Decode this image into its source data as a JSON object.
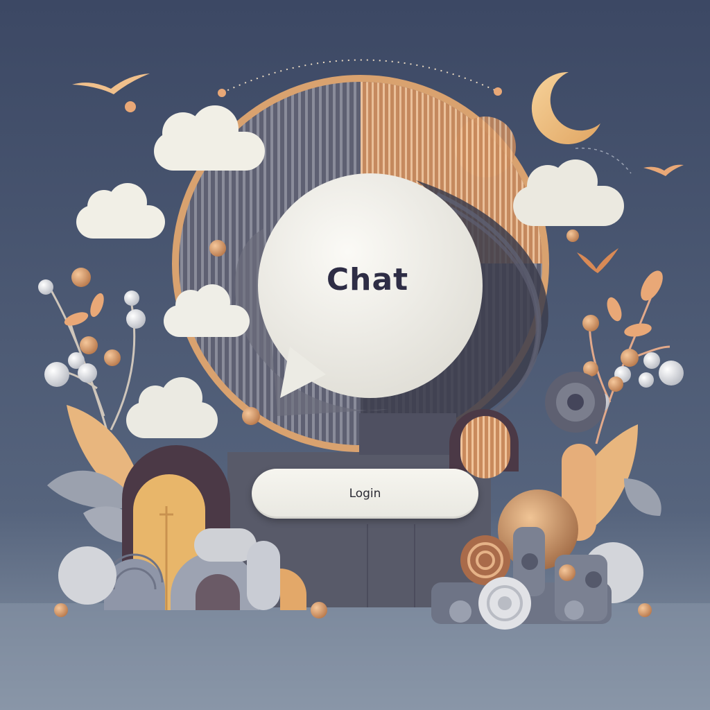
{
  "chat_bubble": {
    "label": "Chat"
  },
  "login_button": {
    "label": "Login"
  },
  "colors": {
    "background_top": "#3e4a66",
    "background_bottom": "#7a8698",
    "floor": "#8694a7",
    "panel": "#575a69",
    "bubble": "#f4f3ee",
    "cloud": "#f1efe6",
    "accent_peach": "#e9a877",
    "accent_gold": "#e6b36a",
    "accent_dark": "#4a3c48",
    "grey_shape": "#8f95a3"
  },
  "icons": [
    "bird-icon",
    "moon-icon",
    "cloud-icon",
    "chat-bubble-icon"
  ]
}
